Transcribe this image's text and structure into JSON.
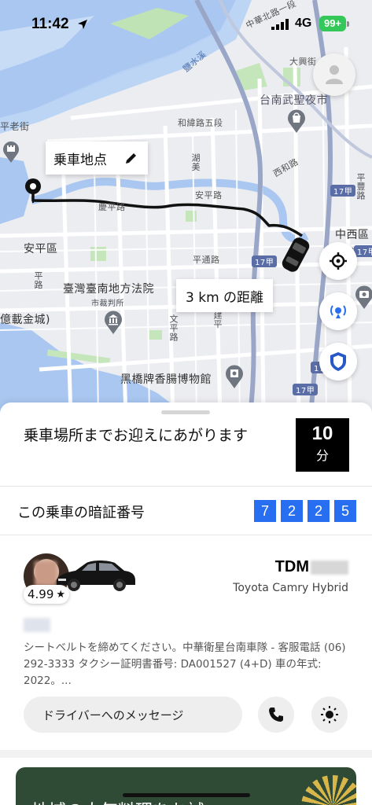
{
  "status": {
    "time": "11:42",
    "network": "4G",
    "battery": "99+"
  },
  "map": {
    "labels": {
      "area_anping_st": "平老街",
      "anping_district": "安平區",
      "court": "臺灣臺南地方法院",
      "court_sub": "市裁判所",
      "golden_castle": "億載金城)",
      "museum": "黑橋牌香腸博物館",
      "temple": "台南武聖夜市",
      "zhongxi": "中西區",
      "datong": "大興街",
      "heyi_rd": "和緯路五段",
      "anping_rd": "安平路",
      "qingping_rd": "慶平路",
      "pingtong_rd": "平通路",
      "ximen_rd": "西和路",
      "zhonghua_rd": "中華北路一段",
      "yanshui": "鹽水溪",
      "north": "北路",
      "huayu_rd": "湖美",
      "wenping_rd": "文平路",
      "jianping": "建平",
      "anping_side": "平路",
      "pingfeng": "平豐路",
      "route17_1": "17甲",
      "route17_2": "17甲",
      "route17_3": "17甲",
      "route17_4": "17甲",
      "route17_5": "17甲"
    },
    "pickup_callout": "乗車地点",
    "distance_callout": "3 km の距離",
    "icons": [
      "profile-icon",
      "recenter-icon",
      "safety-radar-icon",
      "shield-icon",
      "pencil-icon",
      "castle-icon",
      "camera-icon",
      "bank-icon",
      "shopping-bag-icon"
    ]
  },
  "sheet": {
    "eta_text": "乗車場所までお迎えにあがります",
    "eta_minutes": "10",
    "eta_unit": "分",
    "pin_label": "この乗車の暗証番号",
    "pin_digits": [
      "7",
      "2",
      "2",
      "5"
    ],
    "driver": {
      "rating": "4.99",
      "rating_star": "★",
      "plate": "TDM",
      "car_model": "Toyota Camry Hybrid",
      "notice": "シートベルトを締めてください。中華衛星台南車隊 - 客服電話 (06) 292-3333 タクシー証明書番号: DA001527 (4+D) 車の年式: 2022。..."
    },
    "message_button": "ドライバーへのメッセージ",
    "promo_text": "地域の人気料理をお試"
  },
  "colors": {
    "accent_blue": "#276ef1",
    "eta_bg": "#000000",
    "route": "#111111",
    "promo_bg": "#2f4a35"
  }
}
